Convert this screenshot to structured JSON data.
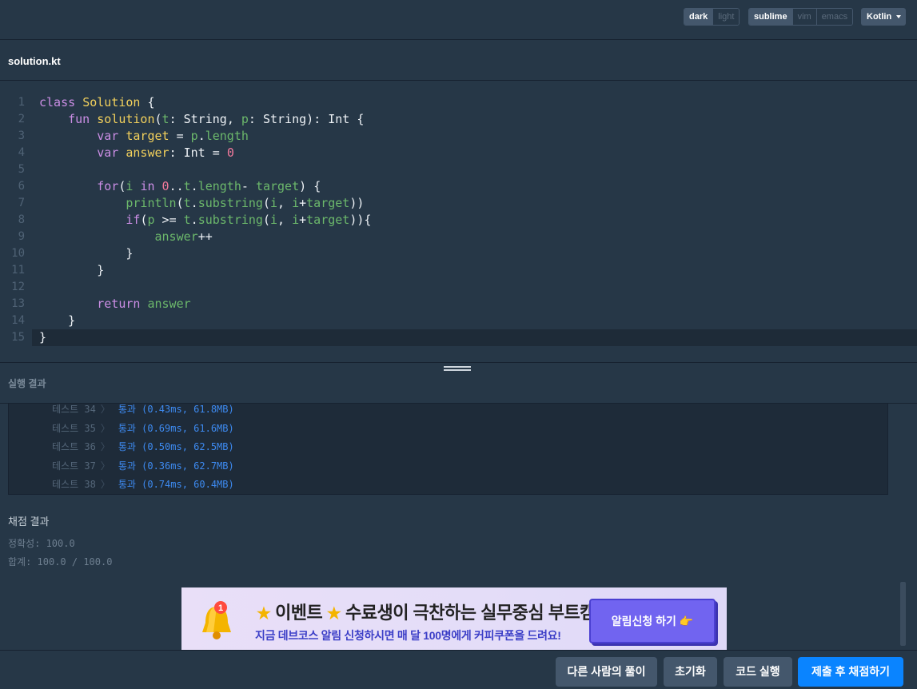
{
  "topbar": {
    "theme_options": [
      "dark",
      "light"
    ],
    "theme_selected": "dark",
    "keymap_options": [
      "sublime",
      "vim",
      "emacs"
    ],
    "keymap_selected": "sublime",
    "language": "Kotlin"
  },
  "file": {
    "name": "solution.kt"
  },
  "editor": {
    "active_line": 15,
    "lines": [
      {
        "n": "1",
        "text": "class Solution {"
      },
      {
        "n": "2",
        "text": "    fun solution(t: String, p: String): Int {"
      },
      {
        "n": "3",
        "text": "        var target = p.length"
      },
      {
        "n": "4",
        "text": "        var answer: Int = 0"
      },
      {
        "n": "5",
        "text": ""
      },
      {
        "n": "6",
        "text": "        for(i in 0..t.length- target) {"
      },
      {
        "n": "7",
        "text": "            println(t.substring(i, i+target))"
      },
      {
        "n": "8",
        "text": "            if(p >= t.substring(i, i+target)){"
      },
      {
        "n": "9",
        "text": "                answer++"
      },
      {
        "n": "10",
        "text": "            }"
      },
      {
        "n": "11",
        "text": "        }"
      },
      {
        "n": "12",
        "text": ""
      },
      {
        "n": "13",
        "text": "        return answer"
      },
      {
        "n": "14",
        "text": "    }"
      },
      {
        "n": "15",
        "text": "}"
      }
    ]
  },
  "result": {
    "title": "실행 결과",
    "tests": [
      {
        "label": "테스트 34",
        "value": "통과 (0.43ms, 61.8MB)"
      },
      {
        "label": "테스트 35",
        "value": "통과 (0.69ms, 61.6MB)"
      },
      {
        "label": "테스트 36",
        "value": "통과 (0.50ms, 62.5MB)"
      },
      {
        "label": "테스트 37",
        "value": "통과 (0.36ms, 62.7MB)"
      },
      {
        "label": "테스트 38",
        "value": "통과 (0.74ms, 60.4MB)"
      }
    ]
  },
  "score": {
    "title": "채점 결과",
    "accuracy": "정확성: 100.0",
    "total": "합계: 100.0 / 100.0"
  },
  "banner": {
    "badge": "1",
    "headline_a": "이벤트",
    "headline_b": "수료생이 극찬하는 실무중심 부트캠프",
    "sub": "지금 데브코스 알림 신청하시면 매 달 100명에게 커피쿠폰을 드려요!",
    "button": "알림신청 하기 👉"
  },
  "footer": {
    "others": "다른 사람의 풀이",
    "reset": "초기화",
    "run": "코드 실행",
    "submit": "제출 후 채점하기"
  },
  "colors": {
    "background": "#263747",
    "panel": "#1e2b39",
    "button": "#44576c",
    "primary": "#0a84ff",
    "pass": "#3d8af0"
  }
}
